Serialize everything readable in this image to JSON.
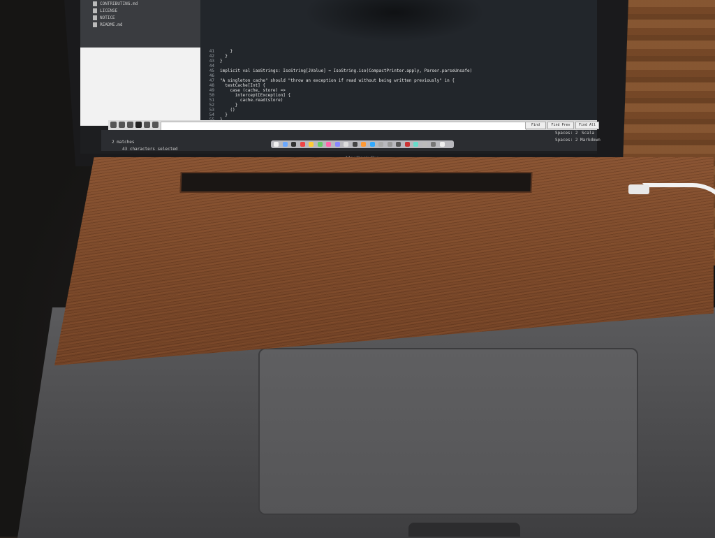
{
  "screen": {
    "sidebar_files": [
      "CONTRIBUTING.md",
      "LICENSE",
      "NOTICE",
      "README.md"
    ],
    "line_numbers": [
      "41",
      "42",
      "43",
      "44",
      "45",
      "46",
      "47",
      "48",
      "49",
      "50",
      "51",
      "52",
      "53",
      "54",
      "55"
    ],
    "code_lines": [
      "    }",
      "  }",
      "}",
      "",
      "implicit val iaoStrings: IsoString[JValue] = IsoString.iso(CompactPrinter.apply, Parser.parseUnsafe)",
      "",
      "\"A singleton cache\" should \"throw an exception if read without being written previously\" in {",
      "  testCache[Int] {",
      "    case (cache, store) =>",
      "      intercept[Exception] {",
      "        cache.read(store)",
      "      }",
      "    ()",
      "  }",
      "}"
    ],
    "find_bar": {
      "find_label": "Find",
      "find_prev_label": "Find Prev",
      "find_all_label": "Find All"
    },
    "status": {
      "matches": "2 matches",
      "selection": "43 characters selected",
      "spaces_1": "Spaces: 2",
      "spaces_2": "Spaces: 2",
      "syntax_1": "Scala",
      "syntax_2": "Markdown"
    },
    "brand": "MacBook Pro"
  },
  "colors": {
    "wood": "#7c4a2b",
    "laptop": "#4a4a4c",
    "editor_bg": "#22262b"
  }
}
